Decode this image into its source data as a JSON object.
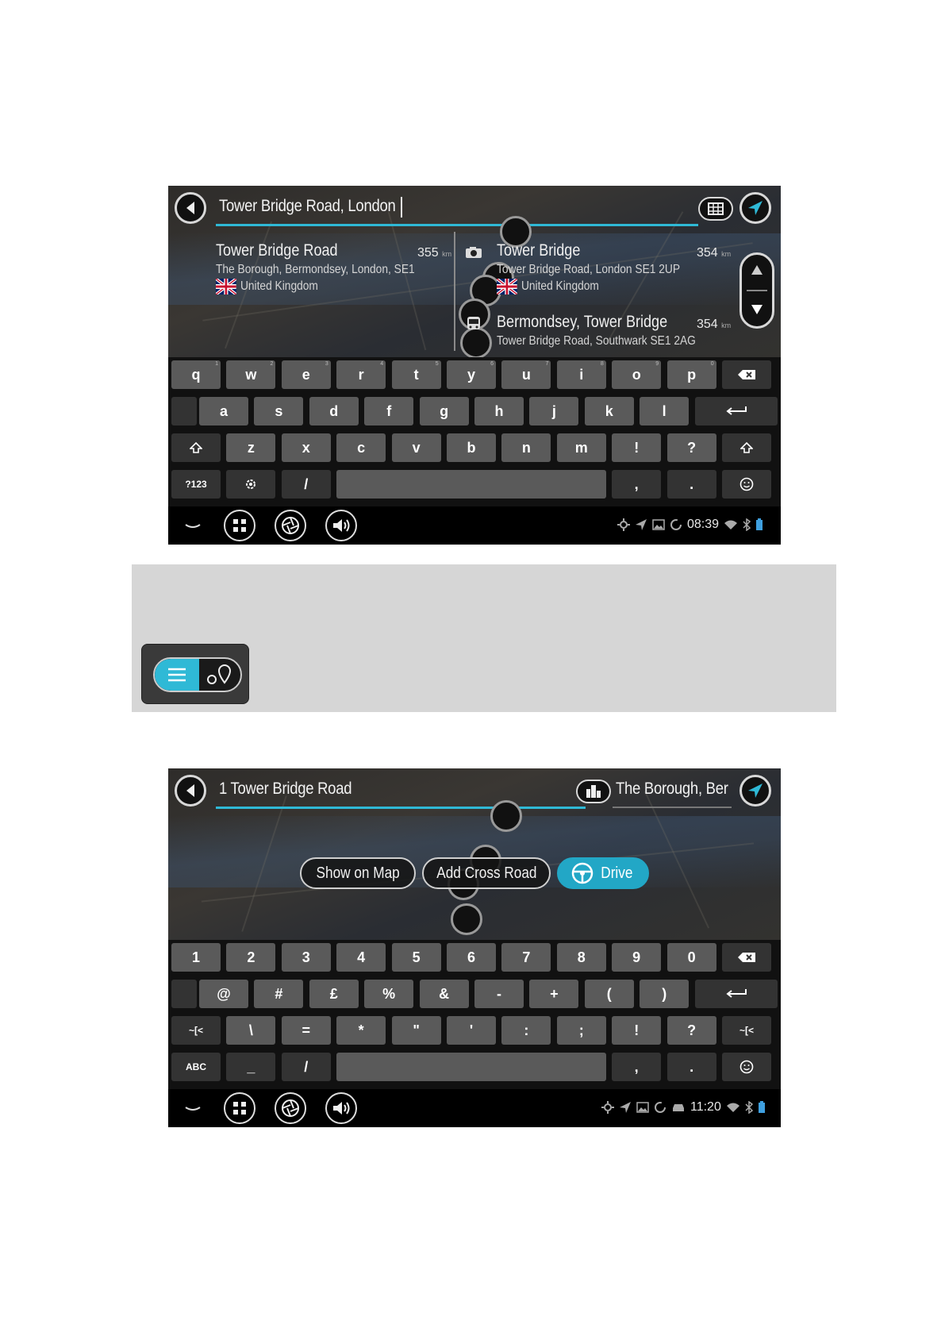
{
  "screen1": {
    "search_value": "Tower Bridge Road, London",
    "results": [
      {
        "title": "Tower Bridge Road",
        "distance": "355",
        "unit": "km",
        "address": "The Borough, Bermondsey, London, SE1",
        "country": "United Kingdom"
      },
      {
        "title": "Tower Bridge",
        "distance": "354",
        "unit": "km",
        "address": "Tower Bridge Road, London SE1 2UP",
        "country": "United Kingdom"
      },
      {
        "title": "Bermondsey, Tower Bridge",
        "distance": "354",
        "unit": "km",
        "address": "Tower Bridge Road, Southwark SE1 2AG"
      }
    ],
    "keyboard": {
      "row1": [
        [
          "q",
          "1"
        ],
        [
          "w",
          "2"
        ],
        [
          "e",
          "3"
        ],
        [
          "r",
          "4"
        ],
        [
          "t",
          "5"
        ],
        [
          "y",
          "6"
        ],
        [
          "u",
          "7"
        ],
        [
          "i",
          "8"
        ],
        [
          "o",
          "9"
        ],
        [
          "p",
          "0"
        ]
      ],
      "row2": [
        "a",
        "s",
        "d",
        "f",
        "g",
        "h",
        "j",
        "k",
        "l"
      ],
      "row3": [
        "z",
        "x",
        "c",
        "v",
        "b",
        "n",
        "m",
        "!",
        "?"
      ],
      "mode_key": "?123",
      "slash": "/",
      "comma": ",",
      "period": "."
    },
    "time": "08:39"
  },
  "screen2": {
    "search_value": "1 Tower Bridge Road",
    "area_value": "The Borough, Ber",
    "actions": {
      "show_on_map": "Show on Map",
      "add_cross_road": "Add Cross Road",
      "drive": "Drive"
    },
    "keyboard": {
      "row1": [
        "1",
        "2",
        "3",
        "4",
        "5",
        "6",
        "7",
        "8",
        "9",
        "0"
      ],
      "row2": [
        "@",
        "#",
        "£",
        "%",
        "&",
        "-",
        "+",
        "(",
        ")"
      ],
      "row3": [
        "\\",
        "=",
        "*",
        "\"",
        "'",
        ":",
        ";",
        "!",
        "?"
      ],
      "side_key": "~[<",
      "mode_key": "ABC",
      "underscore": "_",
      "slash": "/",
      "comma": ",",
      "period": "."
    },
    "time": "11:20"
  },
  "colors": {
    "accent": "#2fb9d6",
    "key": "#5a5a5a",
    "key_dark": "#333333"
  }
}
